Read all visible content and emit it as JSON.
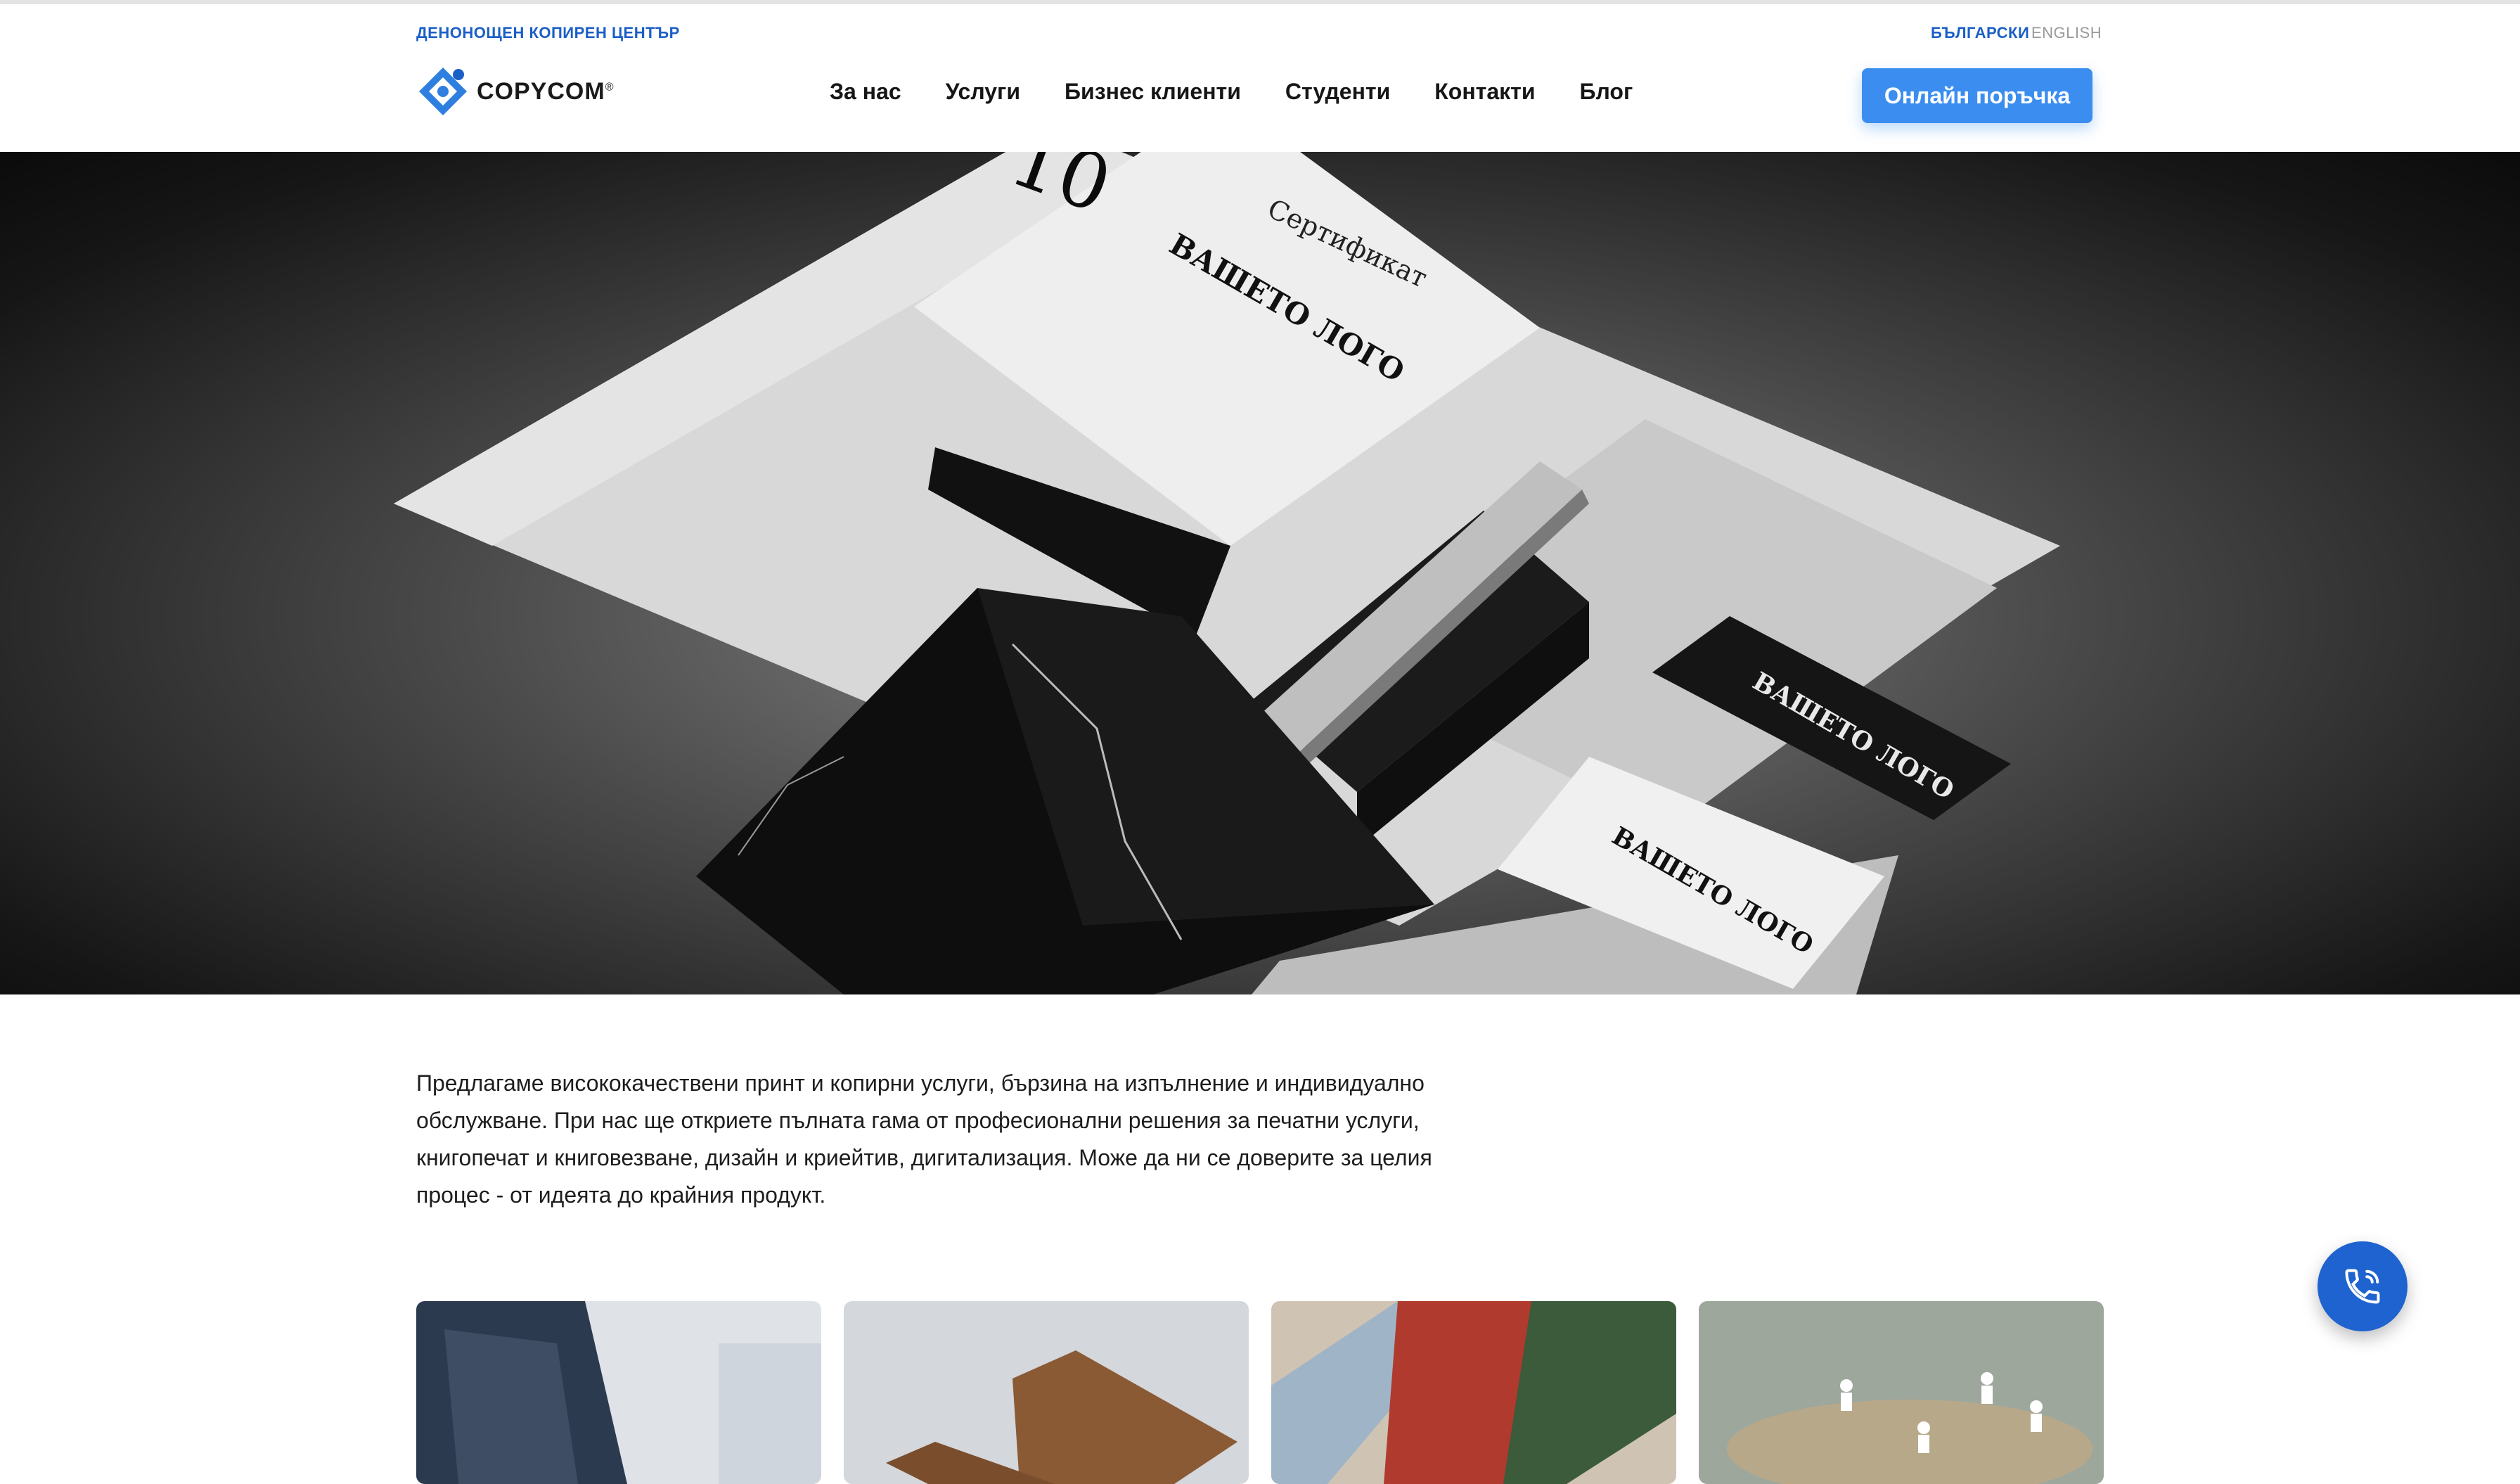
{
  "header": {
    "tagline": "ДЕНОНОЩЕН КОПИРЕН ЦЕНТЪР",
    "languages": [
      "БЪЛГАРСКИ",
      "ENGLISH"
    ],
    "active_language": "БЪЛГАРСКИ",
    "logo_text": "COPYCOM",
    "logo_mark": "®",
    "nav": [
      "За нас",
      "Услуги",
      "Бизнес клиенти",
      "Студенти",
      "Контакти",
      "Блог"
    ],
    "order_button": "Онлайн поръчка"
  },
  "hero": {
    "texts": {
      "number": "10",
      "certificate": "Сертификат",
      "your_logo": "ВАШЕТО ЛОГО"
    }
  },
  "intro": {
    "text": "Предлагаме висококачествени принт и копирни услуги, бързина на изпълнение и индивидуално обслужване. При нас ще откриете пълната гама от професионални решения за печатни услуги, книгопечат и книговезване, дизайн и криейтив, дигитализация. Може да ни се доверите за целия процес - от идеята до крайния продукт."
  },
  "cards": [
    {
      "icon": "photo-jacket"
    },
    {
      "icon": "photo-business-cards"
    },
    {
      "icon": "photo-magazines"
    },
    {
      "icon": "photo-network-people"
    }
  ],
  "floating": {
    "icon": "phone-icon"
  },
  "colors": {
    "accent": "#1b5fc6",
    "button": "#3b8ef0",
    "phone_button": "#1f63d0",
    "text": "#1d1d1d"
  }
}
